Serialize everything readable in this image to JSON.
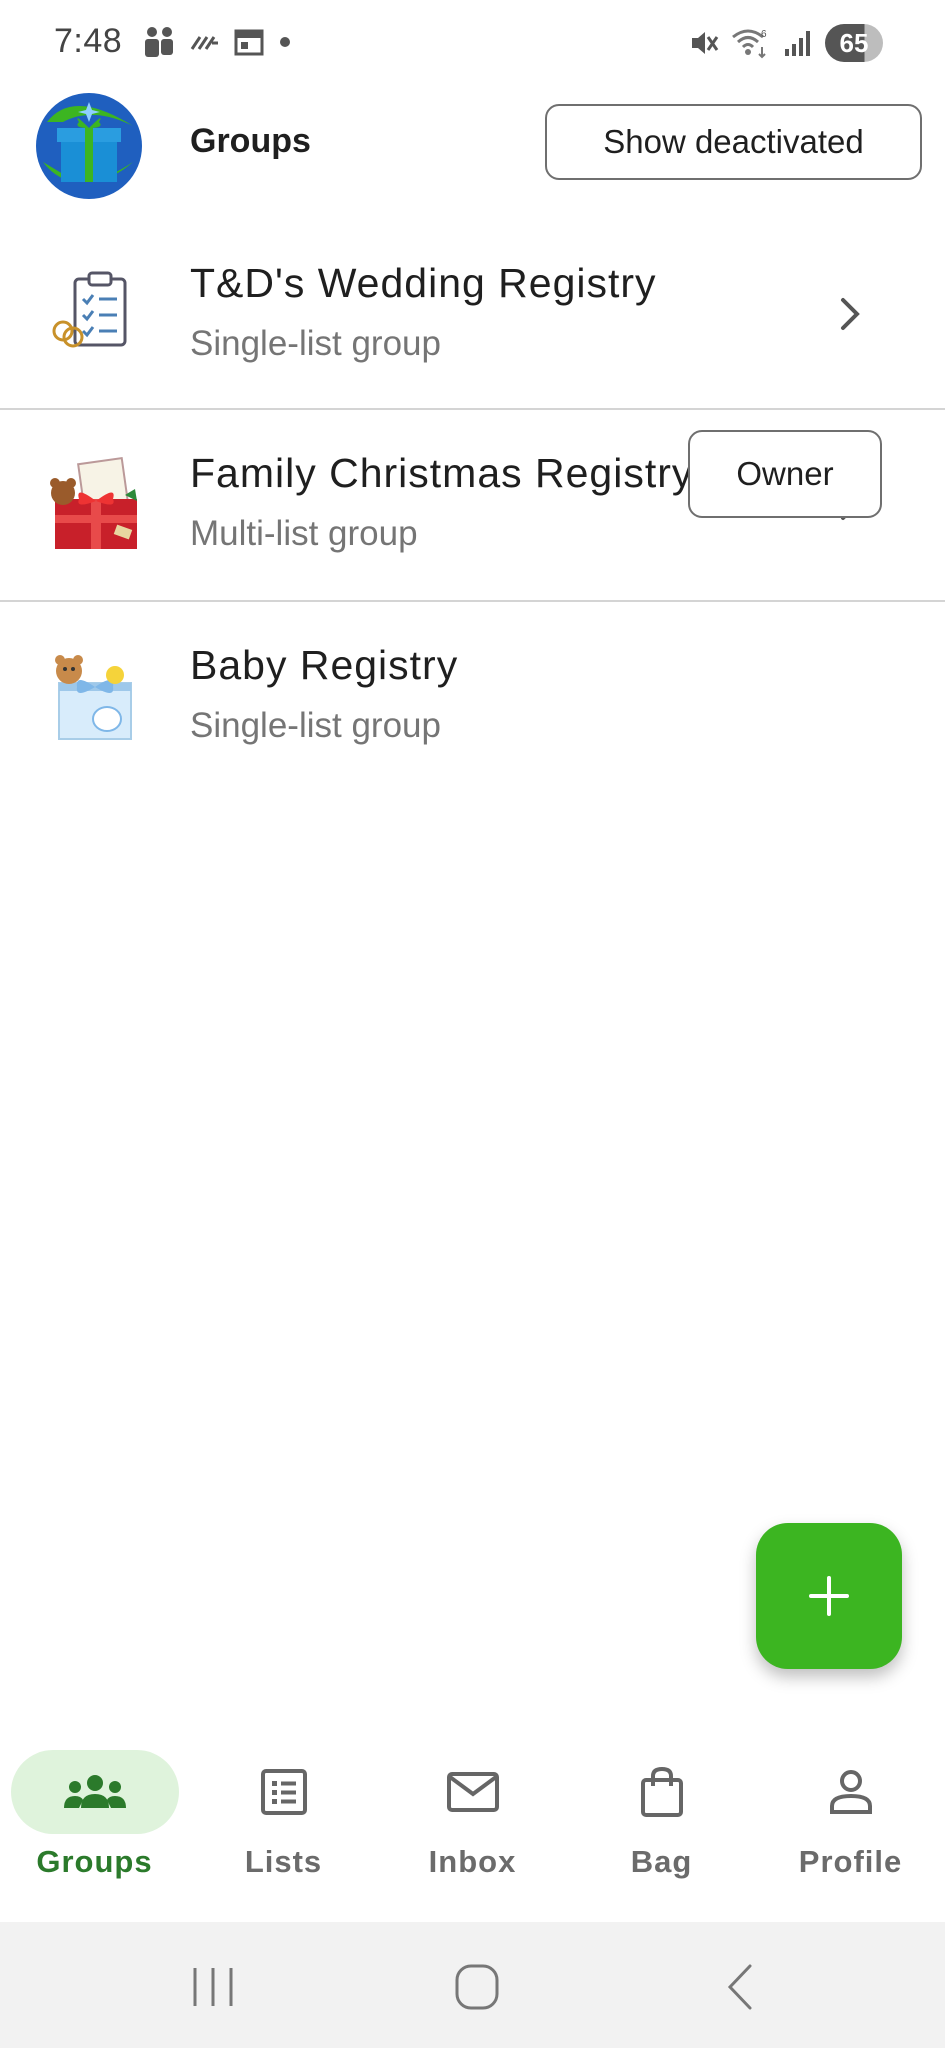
{
  "status_bar": {
    "time": "7:48",
    "battery": "65",
    "left_icons": [
      "teams-icon",
      "nfc-icon",
      "calendar-icon",
      "dot-icon"
    ],
    "right_icons": [
      "mute-icon",
      "wifi-icon",
      "signal-icon",
      "battery-icon"
    ]
  },
  "header": {
    "title": "Groups",
    "show_deactivated_label": "Show deactivated",
    "logo_icon": "gift-logo-icon"
  },
  "groups": [
    {
      "name": "T&D's Wedding Registry",
      "type": "Single-list group",
      "thumb_icon": "wedding-checklist-icon",
      "action": "chevron"
    },
    {
      "name": "Family Christmas Registry",
      "type": "Multi-list group",
      "thumb_icon": "christmas-gift-icon",
      "action": "chevron"
    },
    {
      "name": "Baby Registry",
      "type": "Single-list group",
      "thumb_icon": "baby-gift-icon",
      "action": "badge",
      "badge_label": "Owner"
    }
  ],
  "fab": {
    "icon": "plus-icon"
  },
  "bottom_nav": {
    "items": [
      {
        "label": "Groups",
        "icon": "groups-icon",
        "active": true
      },
      {
        "label": "Lists",
        "icon": "list-icon",
        "active": false
      },
      {
        "label": "Inbox",
        "icon": "mail-icon",
        "active": false
      },
      {
        "label": "Bag",
        "icon": "bag-icon",
        "active": false
      },
      {
        "label": "Profile",
        "icon": "person-icon",
        "active": false
      }
    ]
  },
  "colors": {
    "accent_green": "#3cb521",
    "active_nav_text": "#2b7a2b",
    "active_nav_pill": "#dff3dc",
    "secondary_text": "#757575"
  }
}
